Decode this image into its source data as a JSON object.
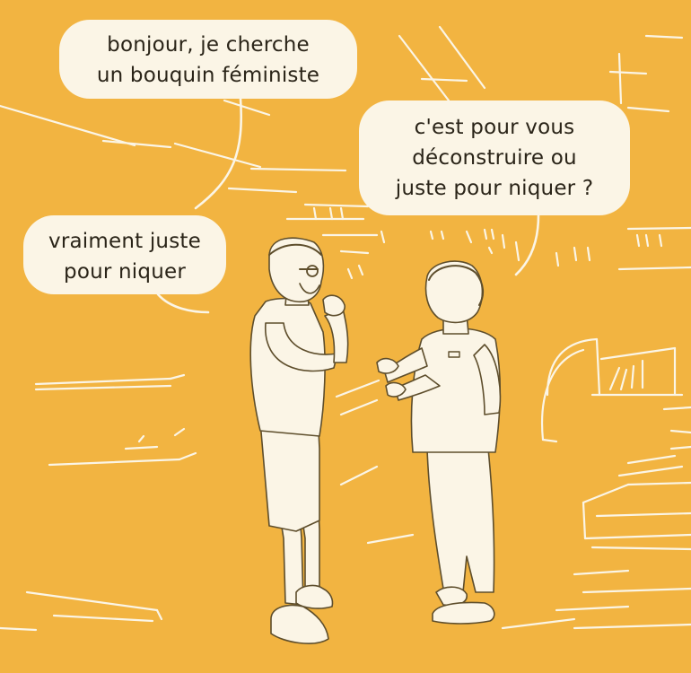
{
  "comic": {
    "background_color": "#f2b441",
    "bubble_color": "#fbf5e6",
    "line_color": "#fbf5e6",
    "ink_color": "#2a2418",
    "bubbles": [
      {
        "speaker": "customer",
        "lines": [
          "bonjour, je cherche",
          "un bouquin féministe"
        ]
      },
      {
        "speaker": "bookseller",
        "lines": [
          "c'est pour vous",
          "déconstruire ou",
          "juste pour niquer ?"
        ]
      },
      {
        "speaker": "customer",
        "lines": [
          "vraiment juste",
          "pour niquer"
        ]
      }
    ]
  }
}
